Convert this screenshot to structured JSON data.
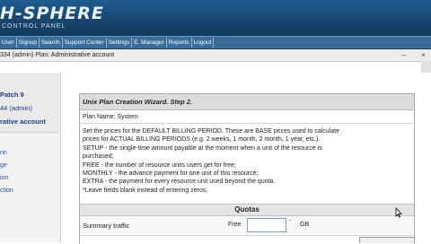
{
  "header": {
    "logo_text": "H-SPHERE",
    "logo_subtitle": "CONTROL PANEL"
  },
  "nav": {
    "items": [
      "User",
      "Signup",
      "Search",
      "Support Center",
      "Settings",
      "E. Manager",
      "Reports",
      "Logout"
    ]
  },
  "userbar": {
    "text": "334 (admin) Plan: Administrative account"
  },
  "sidebar": {
    "version": "Patch 9",
    "account_id": "44 (admin)",
    "role": "rative account",
    "links": [
      "rin",
      "ge",
      "ion",
      "ction"
    ]
  },
  "wizard": {
    "title": "Unix Plan Creation Wizard. Step 2.",
    "plan_name_label": "Plan Name: System",
    "description_lines": [
      "Set the prices for the DEFAULT BILLING PERIOD. These are BASE prices used to calculate",
      "prices for ACTUAL BILLING PERIODS (e.g. 2 weeks, 1 month, 2 month, 1 year, etc.).",
      "SETUP - the single-time amount payable at the moment when a unit of the resource is",
      "purchased;",
      "FREE - the number of resource units users get for free;",
      "MONTHLY - the advance payment for one unit of this resource;",
      "EXTRA - the payment for every resource unit used beyond the quota.",
      "*Leave fields blank instead of entering zeros."
    ],
    "quotas_heading": "Quotas",
    "quota_row": {
      "label": "Summary traffic",
      "free_label": "Free",
      "free_value": "",
      "dash": "-",
      "unit": "GB"
    }
  },
  "colors": {
    "banner": "#1a4c78",
    "navbar": "#3a6d9a",
    "panel_header": "#dcdcdc"
  }
}
